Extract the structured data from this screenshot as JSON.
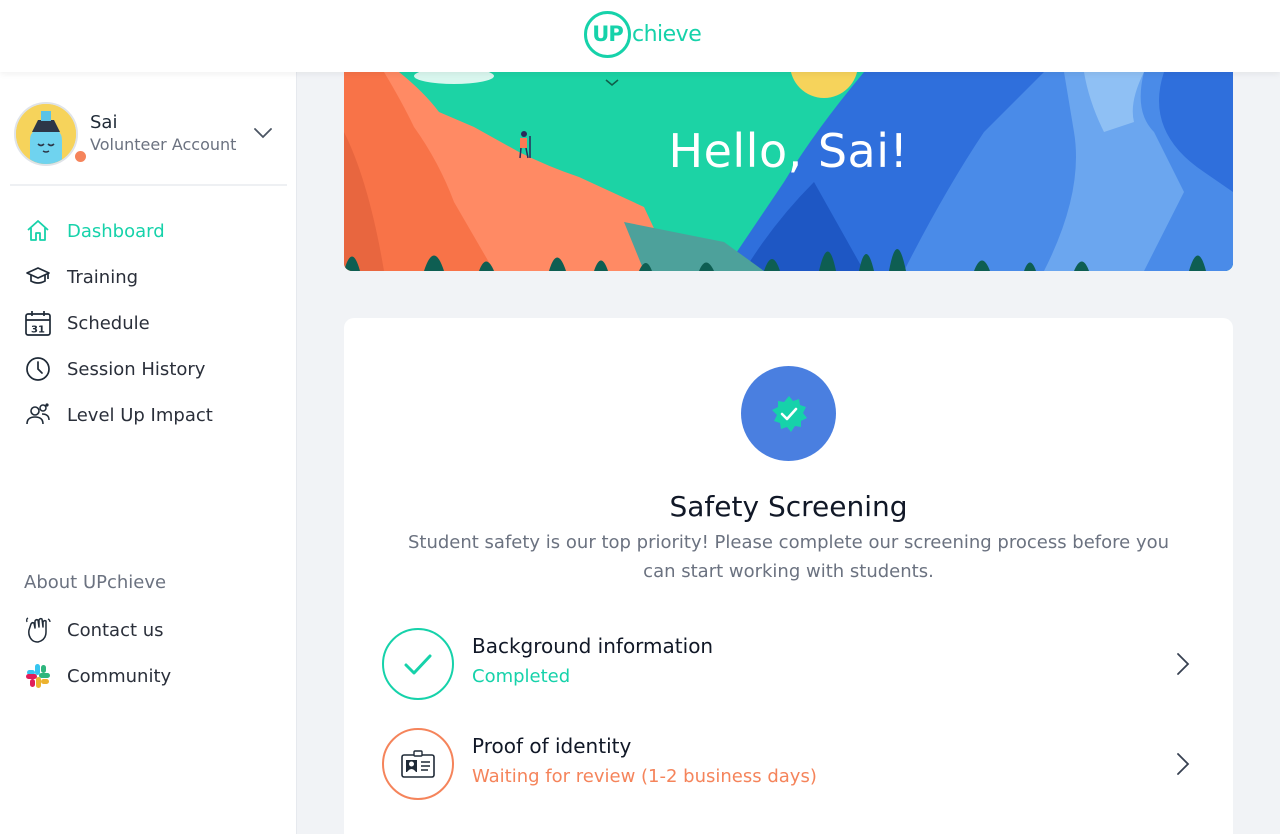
{
  "app": {
    "logo_up": "UP",
    "logo_text": "chieve",
    "brand_color": "#16d2aa"
  },
  "user": {
    "name": "Sai",
    "account_type": "Volunteer Account",
    "status_color": "#f5845b"
  },
  "nav": [
    {
      "label": "Dashboard",
      "icon": "home-icon",
      "active": true
    },
    {
      "label": "Training",
      "icon": "graduation-cap-icon",
      "active": false
    },
    {
      "label": "Schedule",
      "icon": "calendar-icon",
      "active": false
    },
    {
      "label": "Session History",
      "icon": "clock-icon",
      "active": false
    },
    {
      "label": "Level Up Impact",
      "icon": "people-icon",
      "active": false
    }
  ],
  "about": {
    "heading": "About UPchieve",
    "items": [
      {
        "label": "Contact us",
        "icon": "waving-hand-icon"
      },
      {
        "label": "Community",
        "icon": "slack-icon"
      }
    ]
  },
  "calendar_day": "31",
  "hero": {
    "greeting": "Hello, Sai!"
  },
  "safety": {
    "title": "Safety Screening",
    "description": "Student safety is our top priority! Please complete our screening process before you can start working with students.",
    "steps": [
      {
        "title": "Background information",
        "status": "Completed",
        "status_color": "#16d2aa",
        "icon": "checkmark-icon"
      },
      {
        "title": "Proof of identity",
        "status": "Waiting for review (1-2 business days)",
        "status_color": "#f5845b",
        "icon": "id-card-icon"
      }
    ]
  }
}
